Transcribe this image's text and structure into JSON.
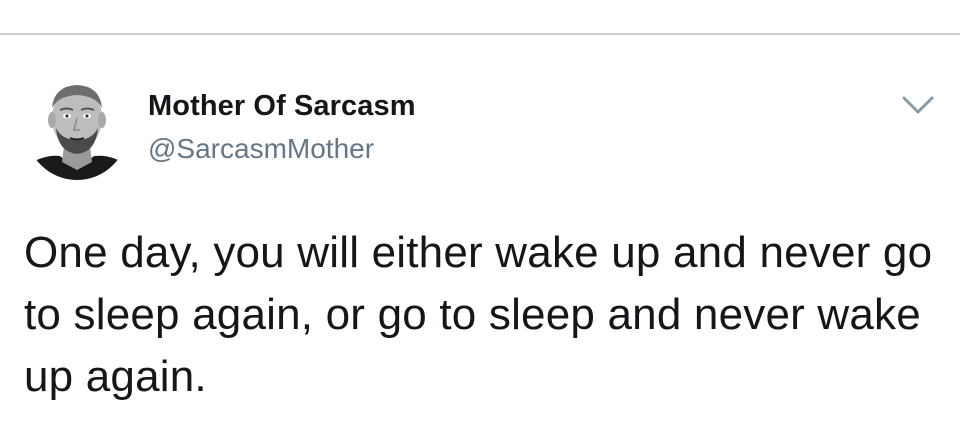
{
  "tweet": {
    "author": {
      "display_name": "Mother Of Sarcasm",
      "handle": "@SarcasmMother",
      "avatar_icon": "profile-photo-bearded-man"
    },
    "menu_icon": "chevron-down-icon",
    "text": "One day, you will either wake up and never go to sleep again, or go to sleep and never wake up again."
  },
  "colors": {
    "text_primary": "#14171a",
    "text_secondary": "#657786",
    "divider": "#c9ced2",
    "background": "#ffffff"
  }
}
